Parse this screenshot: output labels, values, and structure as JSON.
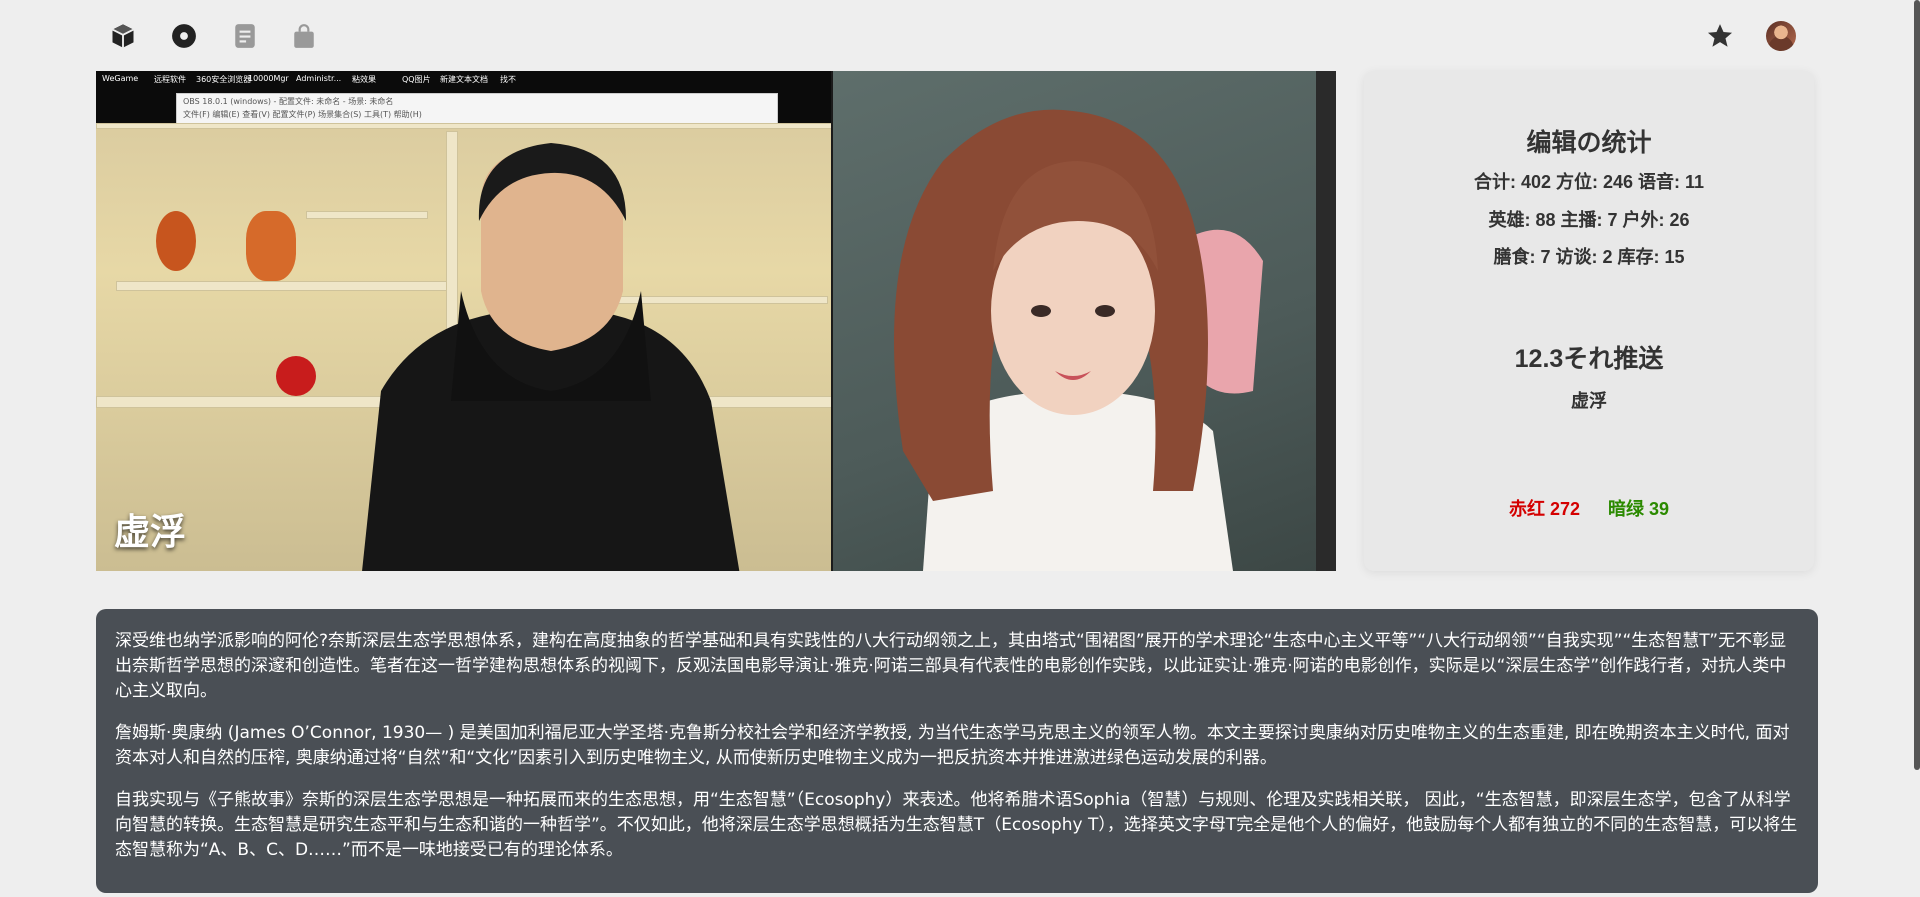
{
  "nav": {
    "left_icons": [
      "cube-icon",
      "disc-icon",
      "document-icon",
      "bag-icon"
    ],
    "right_icons": [
      "star-icon",
      "avatar"
    ]
  },
  "video": {
    "caption": "虚浮",
    "desktop_items": [
      "WeGame",
      "远程软件",
      "360安全浏览器",
      "10000Mgr",
      "Administr...",
      "粘效果",
      "QQ图片",
      "新建文本文档",
      "找不"
    ],
    "obs_title": "OBS 18.0.1 (windows) - 配置文件: 未命名 - 场景: 未命名",
    "obs_menu": "文件(F)  编辑(E)  查看(V)  配置文件(P)  场景集合(S)  工具(T)  帮助(H)"
  },
  "stats": {
    "title": "编辑の统计",
    "line1": "合计: 402 方位: 246 语音: 11",
    "line2": "英雄: 88 主播: 7 户外: 26",
    "line3": "膳食: 7 访谈: 2 库存: 15",
    "push_title": "12.3それ推送",
    "push_name": "虚浮",
    "vote_red": "赤红 272",
    "vote_green": "暗绿 39",
    "colors": {
      "red": "#d40000",
      "green": "#2b8a00"
    }
  },
  "article": {
    "p1": "深受维也纳学派影响的阿伦?奈斯深层生态学思想体系，建构在高度抽象的哲学基础和具有实践性的八大行动纲领之上，其由塔式“围裙图”展开的学术理论“生态中心主义平等”“八大行动纲领”“自我实现”“生态智慧T”无不彰显出奈斯哲学思想的深邃和创造性。笔者在这一哲学建构思想体系的视阈下，反观法国电影导演让·雅克·阿诺三部具有代表性的电影创作实践，以此证实让·雅克·阿诺的电影创作，实际是以“深层生态学”创作践行者，对抗人类中心主义取向。",
    "p2": "詹姆斯·奥康纳 (James O’Connor, 1930— ) 是美国加利福尼亚大学圣塔·克鲁斯分校社会学和经济学教授, 为当代生态学马克思主义的领军人物。本文主要探讨奥康纳对历史唯物主义的生态重建, 即在晚期资本主义时代, 面对资本对人和自然的压榨, 奥康纳通过将“自然”和“文化”因素引入到历史唯物主义, 从而使新历史唯物主义成为一把反抗资本并推进激进绿色运动发展的利器。",
    "p3": "自我实现与《子熊故事》奈斯的深层生态学思想是一种拓展而来的生态思想，用“生态智慧”（Ecosophy）来表述。他将希腊术语Sophia（智慧）与规则、伦理及实践相关联， 因此，“生态智慧，即深层生态学，包含了从科学向智慧的转换。生态智慧是研究生态平和与生态和谐的一种哲学”。不仅如此，他将深层生态学思想概括为生态智慧T（Ecosophy T），选择英文字母T完全是他个人的偏好，他鼓励每个人都有独立的不同的生态智慧，可以将生态智慧称为“A、B、C、D……”而不是一味地接受已有的理论体系。"
  }
}
